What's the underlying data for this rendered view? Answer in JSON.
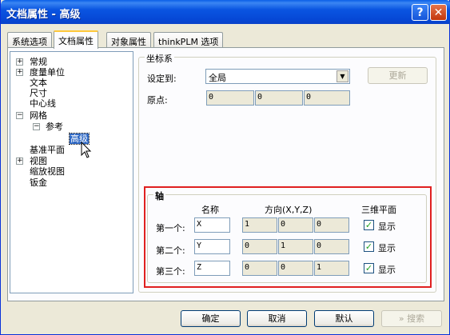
{
  "window": {
    "title": "文档属性 - 高级",
    "help_label": "?",
    "close_label": "✕"
  },
  "tabs": [
    {
      "label": "系统选项"
    },
    {
      "label": "文档属性"
    },
    {
      "label": "对象属性"
    },
    {
      "label": "thinkPLM 选项"
    }
  ],
  "tree": {
    "items": [
      {
        "label": "常规",
        "expander": "+"
      },
      {
        "label": "度量单位",
        "expander": "+"
      },
      {
        "label": "文本"
      },
      {
        "label": "尺寸"
      },
      {
        "label": "中心线"
      },
      {
        "label": "网格",
        "expander": "−"
      },
      {
        "label": "参考",
        "expander": "−"
      },
      {
        "label": "高级"
      },
      {
        "label": "基准平面"
      },
      {
        "label": "视图",
        "expander": "+"
      },
      {
        "label": "缩放视图"
      },
      {
        "label": "钣金"
      }
    ]
  },
  "coord": {
    "title": "坐标系",
    "set_to_label": "设定到:",
    "set_to_value": "全局",
    "update_label": "更新",
    "origin_label": "原点:",
    "origin": [
      "0",
      "0",
      "0"
    ]
  },
  "axes": {
    "title": "轴",
    "col_name": "名称",
    "col_dir": "方向(X,Y,Z)",
    "col_3d": "三维平面",
    "rows": [
      {
        "label": "第一个:",
        "name": "X",
        "dir": [
          "1",
          "0",
          "0"
        ],
        "show_label": "显示",
        "checked": true
      },
      {
        "label": "第二个:",
        "name": "Y",
        "dir": [
          "0",
          "1",
          "0"
        ],
        "show_label": "显示",
        "checked": true
      },
      {
        "label": "第三个:",
        "name": "Z",
        "dir": [
          "0",
          "0",
          "1"
        ],
        "show_label": "显示",
        "checked": true
      }
    ]
  },
  "footer": {
    "ok_label": "确定",
    "cancel_label": "取消",
    "default_label": "默认",
    "search_label": "搜索",
    "search_prefix": "»"
  },
  "colors": {
    "accent_highlight": "#e02020",
    "titlebar": "#0a55e1"
  }
}
